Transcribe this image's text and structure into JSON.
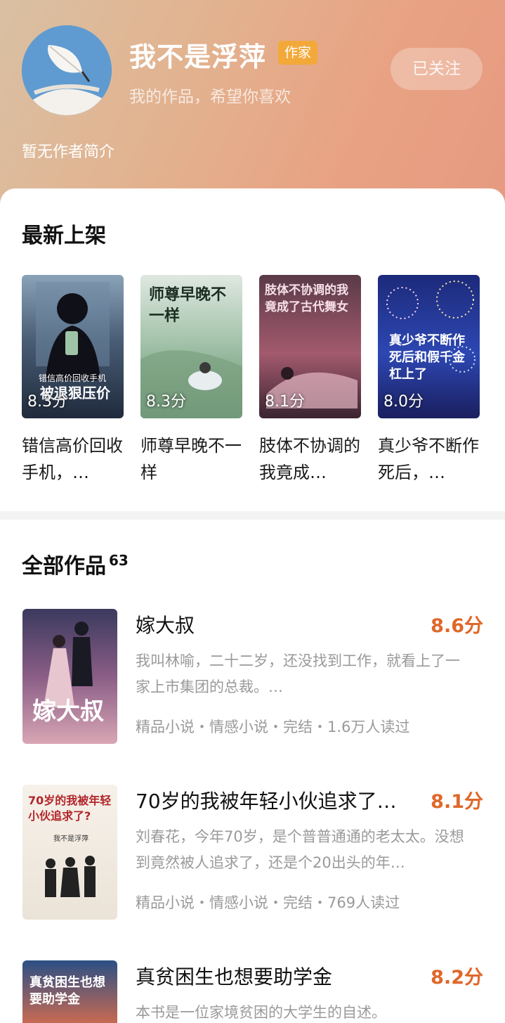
{
  "author": {
    "name": "我不是浮萍",
    "tag": "作家",
    "tagline": "我的作品，希望你喜欢",
    "follow_label": "已关注",
    "intro": "暂无作者简介"
  },
  "latest": {
    "title": "最新上架",
    "books": [
      {
        "title": "错信高价回收手机，…",
        "score": "8.3分",
        "cover_text": "被退狠压价",
        "cover_sub": "错信高价回收手机"
      },
      {
        "title": "师尊早晚不一样",
        "score": "8.3分",
        "cover_text": "师尊早晚不一样",
        "cover_sub": ""
      },
      {
        "title": "肢体不协调的我竟成…",
        "score": "8.1分",
        "cover_text": "肢体不协调的我竟成了古代舞女",
        "cover_sub": ""
      },
      {
        "title": "真少爷不断作死后，…",
        "score": "8.0分",
        "cover_text": "真少爷不断作死后和假千金杠上了",
        "cover_sub": ""
      }
    ]
  },
  "all_works": {
    "title": "全部作品",
    "count": "63",
    "items": [
      {
        "name": "嫁大叔",
        "rating": "8.6分",
        "summary": "我叫林喻，二十二岁，还没找到工作，就看上了一家上市集团的总裁。…",
        "meta": "精品小说・情感小说・完结・1.6万人读过",
        "cover_text": "嫁大叔"
      },
      {
        "name": "70岁的我被年轻小伙追求了…",
        "rating": "8.1分",
        "summary": "刘春花，今年70岁，是个普普通通的老太太。没想到竟然被人追求了，还是个20出头的年…",
        "meta": "精品小说・情感小说・完结・769人读过",
        "cover_text": "70岁的我被年轻小伙追求了?",
        "cover_sub": "我不是浮萍"
      },
      {
        "name": "真贫困生也想要助学金",
        "rating": "8.2分",
        "summary": "本书是一位家境贫困的大学生的自述。",
        "meta": "",
        "cover_text": "真贫困生也想要助学金"
      }
    ]
  }
}
